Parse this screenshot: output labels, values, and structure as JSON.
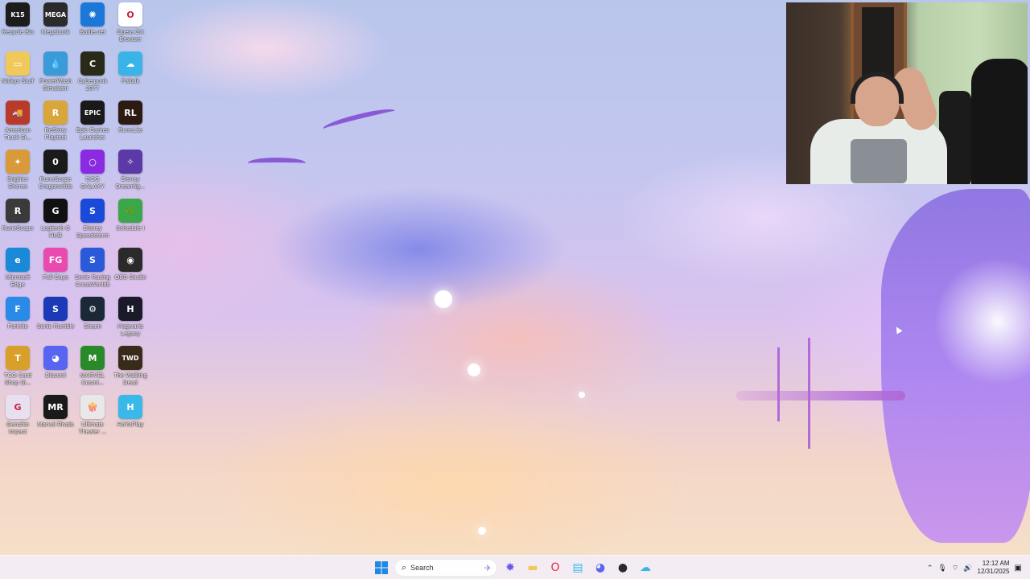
{
  "desktop": {
    "icons": [
      {
        "label": "Recycle Bin",
        "glyph": "K15",
        "color": "#1c1c1c",
        "icon": "recycle-bin-icon"
      },
      {
        "label": "Megabonk",
        "glyph": "MEGA",
        "color": "#2b2b2b",
        "icon": "megabonk-icon"
      },
      {
        "label": "Battle.net",
        "glyph": "✺",
        "color": "#1c78d8",
        "icon": "battlenet-icon"
      },
      {
        "label": "Opera GX Browser",
        "glyph": "O",
        "color": "#ffffff",
        "icon": "opera-gx-icon"
      },
      {
        "label": "Nickys Stuff",
        "glyph": "▭",
        "color": "#f1c85a",
        "icon": "folder-icon"
      },
      {
        "label": "PowerWash Simulator",
        "glyph": "💧",
        "color": "#3a9bd8",
        "icon": "powerwash-icon"
      },
      {
        "label": "Cyberpunk 2077",
        "glyph": "C",
        "color": "#2a2a18",
        "icon": "cyberpunk-icon"
      },
      {
        "label": "Paltalk",
        "glyph": "☁",
        "color": "#3ab4e8",
        "icon": "paltalk-icon"
      },
      {
        "label": "American Truck Si...",
        "glyph": "🚚",
        "color": "#b83a2a",
        "icon": "american-truck-icon"
      },
      {
        "label": "ReStory Playtest",
        "glyph": "R",
        "color": "#d8a63a",
        "icon": "restory-icon"
      },
      {
        "label": "Epic Games Launcher",
        "glyph": "EPIC",
        "color": "#1a1a1a",
        "icon": "epic-games-icon"
      },
      {
        "label": "RuneLite",
        "glyph": "RL",
        "color": "#2b1b12",
        "icon": "runelite-icon"
      },
      {
        "label": "Brighter Shores",
        "glyph": "✦",
        "color": "#d89a3a",
        "icon": "brighter-shores-icon"
      },
      {
        "label": "RuneScape Dragonwilds",
        "glyph": "0",
        "color": "#1a1a1a",
        "icon": "dragonwilds-icon"
      },
      {
        "label": "GOG GALAXY",
        "glyph": "○",
        "color": "#8a2be2",
        "icon": "gog-galaxy-icon"
      },
      {
        "label": "Disney Dreamlig...",
        "glyph": "✧",
        "color": "#5b3aa8",
        "icon": "disney-dreamlight-icon"
      },
      {
        "label": "RuneScape",
        "glyph": "R",
        "color": "#3a3a3a",
        "icon": "runescape-icon"
      },
      {
        "label": "Logitech G HUB",
        "glyph": "G",
        "color": "#111111",
        "icon": "logitech-ghub-icon"
      },
      {
        "label": "Disney Speedstorm",
        "glyph": "S",
        "color": "#1a4ad8",
        "icon": "disney-speedstorm-icon"
      },
      {
        "label": "Schedule I",
        "glyph": "🌿",
        "color": "#3aa84a",
        "icon": "schedule-one-icon"
      },
      {
        "label": "Microsoft Edge",
        "glyph": "e",
        "color": "#1a8ad8",
        "icon": "edge-icon"
      },
      {
        "label": "Fall Guys",
        "glyph": "FG",
        "color": "#e84ab0",
        "icon": "fall-guys-icon"
      },
      {
        "label": "Sonic Racing CrossWorlds",
        "glyph": "S",
        "color": "#2a5ad8",
        "icon": "sonic-racing-icon"
      },
      {
        "label": "OBS Studio",
        "glyph": "◉",
        "color": "#2a2a2a",
        "icon": "obs-studio-icon"
      },
      {
        "label": "Fortnite",
        "glyph": "F",
        "color": "#2a8ae8",
        "icon": "fortnite-icon"
      },
      {
        "label": "Sonic Rumble",
        "glyph": "S",
        "color": "#1a3ab8",
        "icon": "sonic-rumble-icon"
      },
      {
        "label": "Steam",
        "glyph": "⚙",
        "color": "#1b2838",
        "icon": "steam-icon"
      },
      {
        "label": "Hogwarts Legacy",
        "glyph": "H",
        "color": "#1a1a2a",
        "icon": "hogwarts-legacy-icon"
      },
      {
        "label": "TCG Card Shop Si...",
        "glyph": "T",
        "color": "#d8a02a",
        "icon": "tcg-card-shop-icon"
      },
      {
        "label": "Discord",
        "glyph": "◕",
        "color": "#5865f2",
        "icon": "discord-icon"
      },
      {
        "label": "MARVEL Cosmi...",
        "glyph": "M",
        "color": "#2a8a2a",
        "icon": "marvel-cosmic-icon"
      },
      {
        "label": "The Walking Dead",
        "glyph": "TWD",
        "color": "#3a2a1a",
        "icon": "walking-dead-icon"
      },
      {
        "label": "Genshin Impact",
        "glyph": "G",
        "color": "#e8e0f0",
        "icon": "genshin-impact-icon"
      },
      {
        "label": "Marvel Rivals",
        "glyph": "MR",
        "color": "#1a1a1a",
        "icon": "marvel-rivals-icon"
      },
      {
        "label": "Ultimate Theater ...",
        "glyph": "🍿",
        "color": "#e8e8e8",
        "icon": "ultimate-theater-icon"
      },
      {
        "label": "HoYoPlay",
        "glyph": "H",
        "color": "#3ab8e8",
        "icon": "hoyoplay-icon"
      }
    ]
  },
  "taskbar": {
    "search_placeholder": "Search",
    "apps": [
      {
        "icon": "copilot-icon",
        "glyph": "✸",
        "color": "#6a5ae8"
      },
      {
        "icon": "file-explorer-icon",
        "glyph": "▬",
        "color": "#f1c85a"
      },
      {
        "icon": "opera-gx-icon",
        "glyph": "O",
        "color": "#e8284a"
      },
      {
        "icon": "notepad-icon",
        "glyph": "▤",
        "color": "#3ab8e8"
      },
      {
        "icon": "discord-icon",
        "glyph": "◕",
        "color": "#5865f2"
      },
      {
        "icon": "steam-chat-icon",
        "glyph": "●",
        "color": "#2a2a2a"
      },
      {
        "icon": "paltalk-icon",
        "glyph": "☁",
        "color": "#3ab4e8"
      }
    ],
    "clock": {
      "time": "12:12 AM",
      "date": "12/31/2025"
    }
  }
}
